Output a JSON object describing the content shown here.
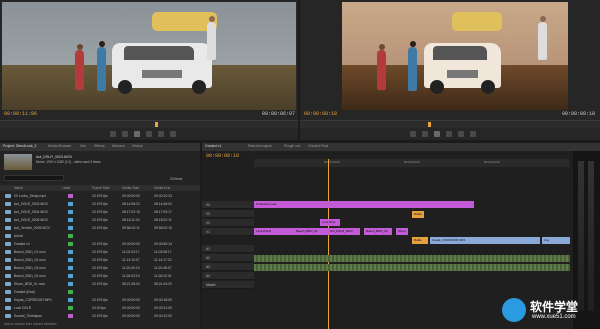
{
  "source_monitor": {
    "timecode_left": "00:00:11:06",
    "timecode_right": "00:00:06:07"
  },
  "program_monitor": {
    "timecode_left": "00:00:08:18",
    "timecode_right": "00:00:08:18"
  },
  "panel_tabs": [
    "Project: DirectLook_3",
    "Media Browser",
    "Info",
    "Effects",
    "Markers",
    "History"
  ],
  "timeline_tabs": [
    "Graded v1",
    "Rate.fwd aglow",
    "Rough cut",
    "Graded Final"
  ],
  "timeline_timecode": "00:00:08:18",
  "ruler_marks": [
    "00:00:14:23",
    "00:00:29:23",
    "00:00:44:22"
  ],
  "project": {
    "clip_name": "Auf_DSLR_0003.MOV",
    "clip_info": "Movie, 1920 x 1080 (1.0) - video used 3 times",
    "item_count": "23 Items",
    "columns": [
      "Name",
      "Label",
      "Frame Rate",
      "Media Start",
      "Media End"
    ],
    "rows": [
      {
        "name": "00 Looks_Setup.mp4",
        "rate": "23.976 fps",
        "start": "00:00:00:00",
        "end": "00:00:10:23",
        "color": "#c05bd0"
      },
      {
        "name": "Auf_DSLR_0003.MOV",
        "rate": "23.976 fps",
        "start": "08:14:38:21",
        "end": "08:14:46:02",
        "color": "#4fa3d8"
      },
      {
        "name": "Auf_DSLR_0004.MOV",
        "rate": "23.976 fps",
        "start": "08:17:02:15",
        "end": "08:17:09:17",
        "color": "#4fa3d8"
      },
      {
        "name": "Auf_DSLR_0005.MOV",
        "rate": "23.976 fps",
        "start": "08:18:11:04",
        "end": "08:18:20:11",
        "color": "#4fa3d8"
      },
      {
        "name": "Auf_Vehicle_0005.MOV",
        "rate": "23.976 fps",
        "start": "09:58:10:11",
        "end": "09:58:20:15",
        "color": "#4fa3d8"
      },
      {
        "name": "Aerial",
        "rate": "",
        "start": "",
        "end": "",
        "color": "#3db24a"
      },
      {
        "name": "Graded v1",
        "rate": "23.976 fps",
        "start": "00:00:00:00",
        "end": "00:00:55:14",
        "color": "#3db24a"
      },
      {
        "name": "Beach_BDD_01.mov",
        "rate": "23.976 fps",
        "start": "11:02:03:17",
        "end": "11:03:08:17",
        "color": "#4fa3d8"
      },
      {
        "name": "Beach_BDD_02.mov",
        "rate": "23.976 fps",
        "start": "11:14:10:07",
        "end": "11:14:17:22",
        "color": "#4fa3d8"
      },
      {
        "name": "Beach_BDD_03.mov",
        "rate": "23.976 fps",
        "start": "11:20:40:10",
        "end": "11:20:48:07",
        "color": "#4fa3d8"
      },
      {
        "name": "Beach_BDD_04.mov",
        "rate": "23.976 fps",
        "start": "11:26:03:14",
        "end": "11:26:12:01",
        "color": "#4fa3d8"
      },
      {
        "name": "Shore_BDD_01.mov",
        "rate": "23.976 fps",
        "start": "08:21:36:02",
        "end": "08:21:44:20",
        "color": "#4fa3d8"
      },
      {
        "name": "Graded (final)",
        "rate": "",
        "start": "",
        "end": "",
        "color": "#3db24a"
      },
      {
        "name": "Kayak_CORRIDOR.MP4",
        "rate": "23.976 fps",
        "start": "00:00:00:00",
        "end": "00:00:18:09",
        "color": "#4fa3d8"
      },
      {
        "name": "Lock DSLR",
        "rate": "24.00 fps",
        "start": "00:00:00:00",
        "end": "00:00:31:09",
        "color": "#3db24a"
      },
      {
        "name": "Sunset_Timelapse",
        "rate": "23.976 fps",
        "start": "00:00:00:00",
        "end": "00:00:12:00",
        "color": "#c05bd0"
      }
    ],
    "footer": "Add or remove from current selection"
  },
  "clips": [
    {
      "label": "Production look",
      "color": "#c45bd6"
    },
    {
      "label": "Lock Shot",
      "color": "#c45bd6"
    },
    {
      "label": "Rattle",
      "color": "#e6a040"
    },
    {
      "label": "Lock DSLR",
      "color": "#c45bd6"
    },
    {
      "label": "Beach_BDD_01",
      "color": "#c45bd6"
    },
    {
      "label": "Auf_DSLR_0003",
      "color": "#c45bd6"
    },
    {
      "label": "Beach_BDD_02",
      "color": "#c45bd6"
    },
    {
      "label": "Shore",
      "color": "#c45bd6"
    },
    {
      "label": "Kayak_CORRIDOR.MP4",
      "color": "#8aa9d8"
    },
    {
      "label": "Rattle",
      "color": "#e6a040"
    },
    {
      "label": "Kay",
      "color": "#8aa9d8"
    }
  ],
  "track_labels": [
    "V4",
    "V3",
    "V2",
    "V1",
    "A1",
    "A2",
    "A3",
    "A4",
    "Master"
  ],
  "watermark": {
    "title": "软件学堂",
    "url": "www.xue51.com"
  }
}
